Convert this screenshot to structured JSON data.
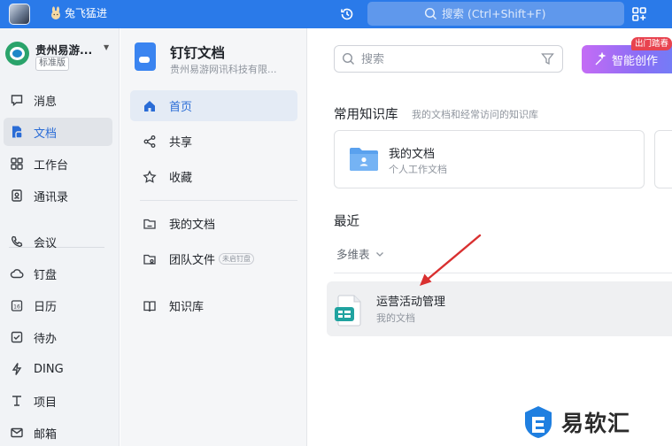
{
  "topbar": {
    "user_name": "兔飞猛进",
    "search_placeholder": "搜索 (Ctrl+Shift+F)",
    "accent": "#2a7ae9"
  },
  "org": {
    "name": "贵州易游...",
    "badge": "标准版"
  },
  "nav": {
    "items": [
      {
        "label": "消息",
        "icon": "message-icon"
      },
      {
        "label": "文档",
        "icon": "document-icon",
        "active": true
      },
      {
        "label": "工作台",
        "icon": "grid-icon"
      },
      {
        "label": "通讯录",
        "icon": "contacts-icon"
      },
      {
        "label": "会议",
        "icon": "phone-icon"
      },
      {
        "label": "钉盘",
        "icon": "cloud-icon"
      },
      {
        "label": "日历",
        "icon": "calendar-icon"
      },
      {
        "label": "待办",
        "icon": "checkbox-icon"
      },
      {
        "label": "DING",
        "icon": "lightning-icon"
      },
      {
        "label": "项目",
        "icon": "project-icon"
      },
      {
        "label": "邮箱",
        "icon": "mail-icon"
      }
    ]
  },
  "docs": {
    "title": "钉钉文档",
    "subtitle": "贵州易游网讯科技有限...",
    "menu": [
      {
        "label": "首页",
        "icon": "home-icon",
        "active": true
      },
      {
        "label": "共享",
        "icon": "share-icon"
      },
      {
        "label": "收藏",
        "icon": "star-icon"
      },
      {
        "label": "我的文档",
        "icon": "folder-icon"
      },
      {
        "label": "团队文件",
        "icon": "team-folder-icon",
        "badge": "未启钉盘"
      },
      {
        "label": "知识库",
        "icon": "book-icon"
      }
    ]
  },
  "main": {
    "search_placeholder": "搜索",
    "ai_button": "智能创作",
    "ai_tag": "出门踏春",
    "kb_title": "常用知识库",
    "kb_subtitle": "我的文档和经常访问的知识库",
    "kb_card": {
      "name": "我的文档",
      "desc": "个人工作文档"
    },
    "recent_title": "最近",
    "filter": "多维表",
    "recent_items": [
      {
        "name": "运营活动管理",
        "location": "我的文档"
      }
    ]
  },
  "watermark": {
    "text": "易软汇"
  }
}
